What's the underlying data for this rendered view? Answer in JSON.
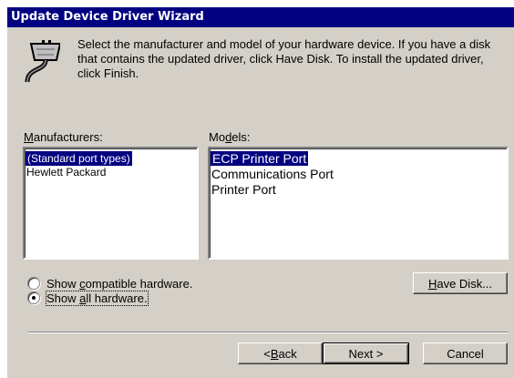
{
  "window": {
    "title": "Update Device Driver Wizard"
  },
  "intro": {
    "icon": "connector-cable-icon",
    "text": "Select the manufacturer and model of your hardware device. If you have a disk that contains the updated driver, click Have Disk. To install the updated driver, click Finish."
  },
  "manufacturers": {
    "label_mnemonic": "M",
    "label_rest": "anufacturers:",
    "items": [
      "(Standard port types)",
      "Hewlett Packard"
    ],
    "selected_index": 0
  },
  "models": {
    "label_pre": "Mo",
    "label_mnemonic": "d",
    "label_post": "els:",
    "items": [
      "ECP Printer Port",
      "Communications Port",
      "Printer Port"
    ],
    "selected_index": 0
  },
  "options": {
    "compatible": {
      "pre": "Show ",
      "mnemonic": "c",
      "post": "ompatible hardware.",
      "checked": false
    },
    "all": {
      "pre": "Show ",
      "mnemonic": "a",
      "post": "ll hardware.",
      "checked": true
    }
  },
  "buttons": {
    "have_disk": {
      "mnemonic": "H",
      "rest": "ave Disk..."
    },
    "back": {
      "pre": "< ",
      "mnemonic": "B",
      "rest": "ack"
    },
    "next": "Next >",
    "cancel": "Cancel"
  }
}
